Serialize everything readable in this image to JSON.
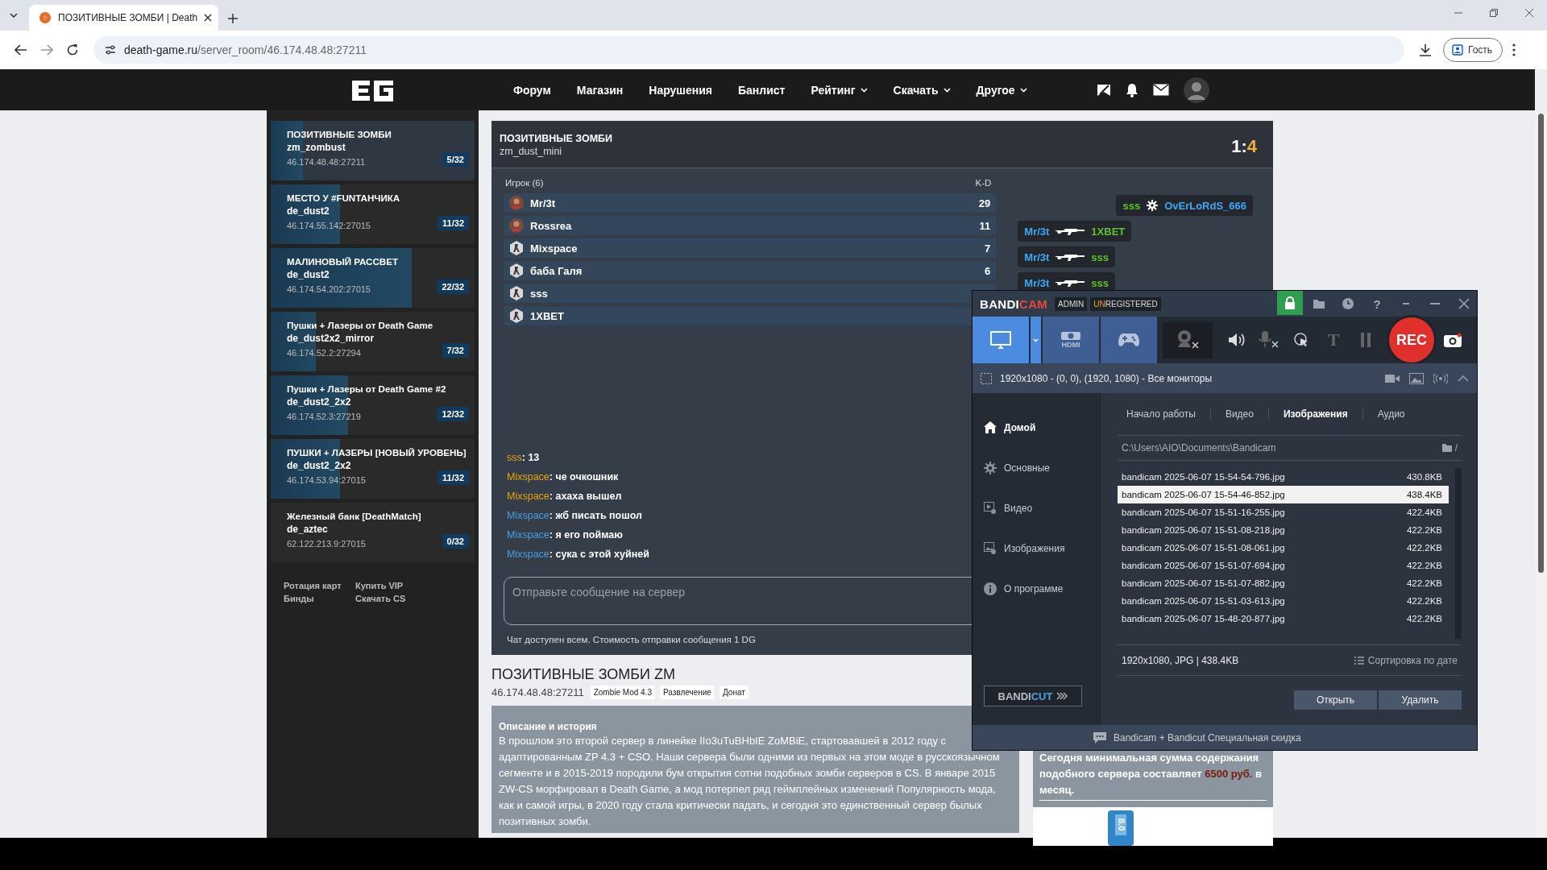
{
  "browser": {
    "tab_title": "ПОЗИТИВНЫЕ ЗОМБИ | Death",
    "url_host": "death-game.ru",
    "url_path": "/server_room/46.174.48.48:27211",
    "profile_label": "Гость"
  },
  "site_nav": [
    {
      "label": "Форум",
      "dropdown": false
    },
    {
      "label": "Магазин",
      "dropdown": false
    },
    {
      "label": "Нарушения",
      "dropdown": false
    },
    {
      "label": "Банлист",
      "dropdown": false
    },
    {
      "label": "Рейтинг",
      "dropdown": true
    },
    {
      "label": "Скачать",
      "dropdown": true
    },
    {
      "label": "Другое",
      "dropdown": true
    }
  ],
  "servers": [
    {
      "name": "ПОЗИТИВНЫЕ ЗОМБИ",
      "map": "zm_zombust",
      "address": "46.174.48.48:27211",
      "players": "5/32",
      "level": 0.16,
      "selected": true
    },
    {
      "name": "МЕСТО У #FUNТАНЧИКА",
      "map": "de_dust2",
      "address": "46.174.55.142:27015",
      "players": "11/32",
      "level": 0.34,
      "selected": false
    },
    {
      "name": "МАЛИНОВЫЙ РАССВЕТ",
      "map": "de_dust2",
      "address": "46.174.54.202:27015",
      "players": "22/32",
      "level": 0.69,
      "selected": false
    },
    {
      "name": "Пушки + Лазеры от Death Game",
      "map": "de_dust2x2_mirror",
      "address": "46.174.52.2:27294",
      "players": "7/32",
      "level": 0.22,
      "selected": false
    },
    {
      "name": "Пушки + Лазеры от Death Game #2",
      "map": "de_dust2_2x2",
      "address": "46.174.52.3:27219",
      "players": "12/32",
      "level": 0.38,
      "selected": false
    },
    {
      "name": "ПУШКИ + ЛАЗЕРЫ [НОВЫЙ УРОВЕНЬ]",
      "map": "de_dust2_2x2",
      "address": "46.174.53.94:27015",
      "players": "11/32",
      "level": 0.34,
      "selected": false
    },
    {
      "name": "Железный банк [DeathMatch]",
      "map": "de_aztec",
      "address": "62.122.213.9:27015",
      "players": "0/32",
      "selected": false
    }
  ],
  "sidebar_links": [
    "Ротация карт",
    "Купить VIP",
    "Бинды",
    "Скачать CS"
  ],
  "room": {
    "title": "ПОЗИТИВНЫЕ ЗОМБИ",
    "map": "zm_dust_mini",
    "score": {
      "home": "1",
      "separator": ":",
      "away": "4"
    },
    "players_header": "Игрок (6)",
    "kd_header": "K-D",
    "players": [
      {
        "name": "Mr/3t",
        "kd": "29",
        "kind": "photo"
      },
      {
        "name": "Rossrea",
        "kd": "11",
        "kind": "photo"
      },
      {
        "name": "Mixspace",
        "kd": "7",
        "kind": "default"
      },
      {
        "name": "баба Галя",
        "kd": "6",
        "kind": "default"
      },
      {
        "name": "sss",
        "kind": "default"
      },
      {
        "name": "1XBET",
        "kind": "default"
      }
    ],
    "kill_feed": [
      {
        "kind": "gear",
        "killer": {
          "name": "sss",
          "color": "#5ec22a"
        },
        "victim": {
          "name": "OvErLoRdS_666",
          "color": "#3fa9f5"
        }
      },
      {
        "kind": "rifle",
        "killer": {
          "name": "Mr/3t",
          "color": "#3fa9f5"
        },
        "victim": {
          "name": "1XBET",
          "color": "#5ec22a"
        }
      },
      {
        "kind": "rifle",
        "killer": {
          "name": "Mr/3t",
          "color": "#3fa9f5"
        },
        "victim": {
          "name": "sss",
          "color": "#5ec22a"
        }
      },
      {
        "kind": "rifle",
        "killer": {
          "name": "Mr/3t",
          "color": "#3fa9f5"
        },
        "victim": {
          "name": "sss",
          "color": "#5ec22a"
        }
      }
    ],
    "chat": [
      {
        "author": "sss",
        "color": "#e8a40c",
        "text": ": 13"
      },
      {
        "author": "Mixspace",
        "color": "#e8a40c",
        "text": ": че очкошник"
      },
      {
        "author": "Mixspace",
        "color": "#e8a40c",
        "text": ": ахаха вышел"
      },
      {
        "author": "Mixspace",
        "color": "#4a9fe0",
        "text": ": жб писать пошол"
      },
      {
        "author": "Mixspace",
        "color": "#4a9fe0",
        "text": ": я его поймаю"
      },
      {
        "author": "Mixspace",
        "color": "#4a9fe0",
        "text": ": сука с этой хуйней"
      }
    ],
    "chat_input": {
      "placeholder": "Отправьте сообщение на сервер"
    },
    "chat_note": "Чат доступен всем. Стоимость отправки сообщения 1 DG"
  },
  "server_info": {
    "title": "ПОЗИТИВНЫЕ ЗОМБИ ZM",
    "address": "46.174.48.48:27211",
    "tags": [
      "Zombie Mod 4.3",
      "Развлечение",
      "Донат"
    ],
    "description_title": "Описание и история",
    "description": "В прошлом это второй сервер в линейке IIo3uTuBHbIE ZoMBiE, стартовавшей в 2012 году с адаптированным ZP 4.3 + CSO. Наши сервера были одними из первых на этом моде в русскоязычном сегменте и в 2015-2019 породили бум открытия сотни подобных зомби серверов в CS. В январе 2015 ZW-CS морфировал в Death Game, а мод потерпел ряд геймплейных изменений Популярность мода, как и самой игры, в 2020 году стала критически падать, и сегодня это единственный сервер былых позитивных зомби.",
    "cost_text": "Сегодня минимальная сумма содержания подобного сервера составляет **6500 руб.** в месяц.",
    "rating_badge": "8.0"
  },
  "bandicam": {
    "logo_left": "BANDI",
    "logo_right": "CAM",
    "role_badge": "ADMIN",
    "license_prefix": "UN",
    "license_text": "REGISTERED",
    "help_glyph": "?",
    "modes": [
      {
        "kind": "screen",
        "selected": true
      },
      {
        "kind": "hdmi",
        "label": "HDMI",
        "selected": false
      },
      {
        "kind": "game",
        "selected": false
      }
    ],
    "text_tool_glyph": "T",
    "rec_label": "REC",
    "area": "1920x1080 - (0, 0), (1920, 1080) - Все мониторы",
    "nav": [
      {
        "kind": "home",
        "label": "Домой",
        "selected": true
      },
      {
        "kind": "gear",
        "label": "Основные",
        "selected": false
      },
      {
        "kind": "video",
        "label": "Видео",
        "selected": false
      },
      {
        "kind": "image",
        "label": "Изображения",
        "selected": false
      },
      {
        "kind": "info",
        "label": "О программе",
        "selected": false
      }
    ],
    "bandicut_left": "BANDI",
    "bandicut_right": "CUT",
    "tabs": [
      {
        "label": "Начало работы",
        "selected": false
      },
      {
        "label": "Видео",
        "selected": false
      },
      {
        "label": "Изображения",
        "selected": true
      },
      {
        "label": "Аудио",
        "selected": false
      }
    ],
    "path": "C:\\Users\\AIO\\Documents\\Bandicam",
    "path_suffix": "/",
    "files": [
      {
        "name": "bandicam 2025-06-07 15-54-54-796.jpg",
        "size": "430.8KB",
        "selected": false
      },
      {
        "name": "bandicam 2025-06-07 15-54-46-852.jpg",
        "size": "438.4KB",
        "selected": true
      },
      {
        "name": "bandicam 2025-06-07 15-51-16-255.jpg",
        "size": "422.4KB",
        "selected": false
      },
      {
        "name": "bandicam 2025-06-07 15-51-08-218.jpg",
        "size": "422.2KB",
        "selected": false
      },
      {
        "name": "bandicam 2025-06-07 15-51-08-061.jpg",
        "size": "422.2KB",
        "selected": false
      },
      {
        "name": "bandicam 2025-06-07 15-51-07-694.jpg",
        "size": "422.2KB",
        "selected": false
      },
      {
        "name": "bandicam 2025-06-07 15-51-07-882.jpg",
        "size": "422.2KB",
        "selected": false
      },
      {
        "name": "bandicam 2025-06-07 15-51-03-613.jpg",
        "size": "422.2KB",
        "selected": false
      },
      {
        "name": "bandicam 2025-06-07 15-48-20-877.jpg",
        "size": "422.2KB",
        "selected": false
      }
    ],
    "file_info": "1920x1080, JPG | 438.4KB",
    "sort_label": "Сортировка по дате",
    "buttons": [
      "Открыть",
      "Удалить"
    ],
    "promo": "Bandicam + Bandicut Специальная скидка"
  }
}
